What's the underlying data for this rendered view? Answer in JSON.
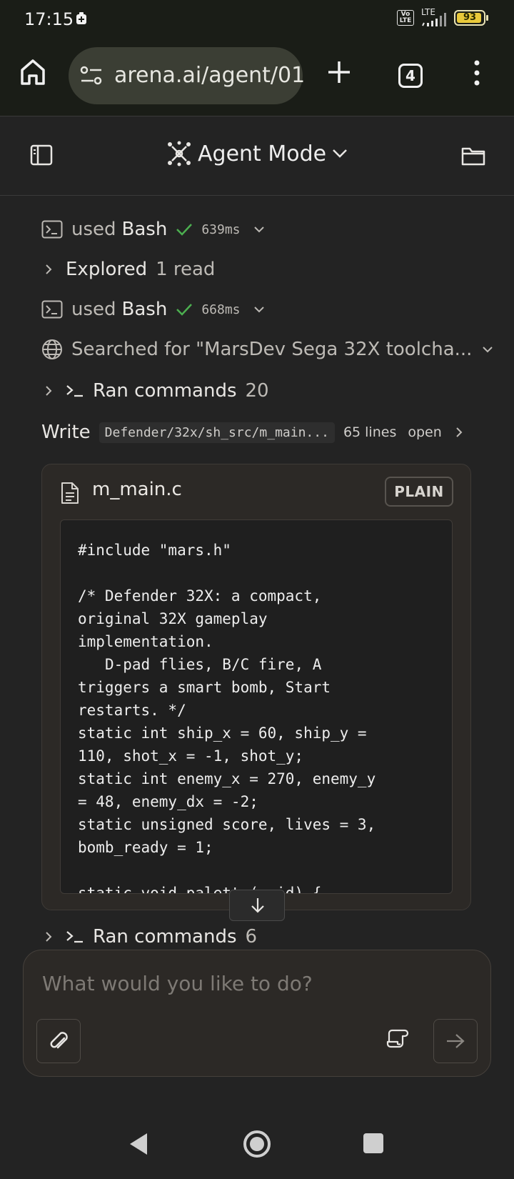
{
  "status_bar": {
    "time": "17:15",
    "volte": "Vo LTE",
    "network": "LTE",
    "battery": "93"
  },
  "browser": {
    "url": "arena.ai/agent/01",
    "tab_count": "4"
  },
  "app_bar": {
    "mode_label": "Agent Mode"
  },
  "activity": [
    {
      "prefix": "used",
      "tool": "Bash",
      "duration": "639ms"
    },
    {
      "title": "Explored",
      "count": "1 read"
    },
    {
      "prefix": "used",
      "tool": "Bash",
      "duration": "668ms"
    },
    {
      "text": "Searched for \"MarsDev Sega 32X toolcha..."
    },
    {
      "title": "Ran commands",
      "count": "20"
    },
    {
      "title": "Write",
      "path": "Defender/32x/sh_src/m_main...",
      "lines": "65 lines",
      "action": "open"
    }
  ],
  "file_card": {
    "filename": "m_main.c",
    "language_badge": "PLAIN",
    "code": "#include \"mars.h\"\n\n/* Defender 32X: a compact,\noriginal 32X gameplay\nimplementation.\n   D-pad flies, B/C fire, A\ntriggers a smart bomb, Start\nrestarts. */\nstatic int ship_x = 60, ship_y =\n110, shot_x = -1, shot_y;\nstatic int enemy_x = 270, enemy_y\n= 48, enemy_dx = -2;\nstatic unsigned score, lives = 3,\nbomb_ready = 1;\n\nstatic void palette(void) {"
  },
  "after_card": {
    "title": "Ran commands",
    "count": "6"
  },
  "composer": {
    "placeholder": "What would you like to do?"
  },
  "colors": {
    "check": "#4caf50",
    "background": "#232323",
    "card": "#2c2926"
  }
}
